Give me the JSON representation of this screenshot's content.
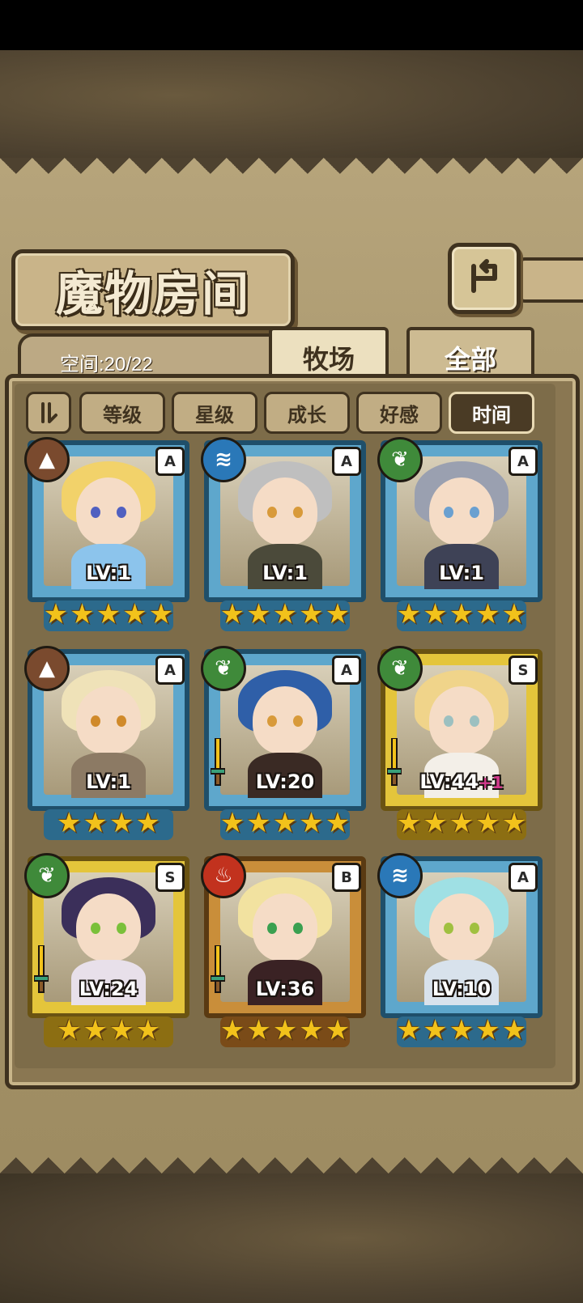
{
  "title": "魔物房间",
  "back_icon": "back-arrow-icon",
  "space": {
    "label": "空间:20/22"
  },
  "tabs": [
    {
      "label": "牧场",
      "active": true
    },
    {
      "label": "全部",
      "active": false
    }
  ],
  "sort": {
    "toggle_icon": "sort-order-icon",
    "buttons": [
      {
        "label": "等级",
        "active": false
      },
      {
        "label": "星级",
        "active": false
      },
      {
        "label": "成长",
        "active": false
      },
      {
        "label": "好感",
        "active": false
      },
      {
        "label": "时间",
        "active": true
      }
    ]
  },
  "monsters": [
    {
      "level": "LV:1",
      "bonus": "",
      "rank": "A",
      "element": "earth",
      "element_icon": "mountain-icon",
      "stars": 5,
      "frame": "blue",
      "has_sword": false
    },
    {
      "level": "LV:1",
      "bonus": "",
      "rank": "A",
      "element": "water",
      "element_icon": "wave-icon",
      "stars": 5,
      "frame": "blue",
      "has_sword": false
    },
    {
      "level": "LV:1",
      "bonus": "",
      "rank": "A",
      "element": "nature",
      "element_icon": "leaf-icon",
      "stars": 5,
      "frame": "blue",
      "has_sword": false
    },
    {
      "level": "LV:1",
      "bonus": "",
      "rank": "A",
      "element": "earth",
      "element_icon": "mountain-icon",
      "stars": 4,
      "frame": "blue",
      "has_sword": false
    },
    {
      "level": "LV:20",
      "bonus": "",
      "rank": "A",
      "element": "nature",
      "element_icon": "leaf-icon",
      "stars": 5,
      "frame": "blue",
      "has_sword": true
    },
    {
      "level": "LV:44",
      "bonus": "+1",
      "rank": "S",
      "element": "nature",
      "element_icon": "leaf-icon",
      "stars": 5,
      "frame": "gold",
      "has_sword": true
    },
    {
      "level": "LV:24",
      "bonus": "",
      "rank": "S",
      "element": "nature",
      "element_icon": "leaf-icon",
      "stars": 4,
      "frame": "gold",
      "has_sword": true
    },
    {
      "level": "LV:36",
      "bonus": "",
      "rank": "B",
      "element": "fire",
      "element_icon": "flame-icon",
      "stars": 5,
      "frame": "bronze",
      "has_sword": true
    },
    {
      "level": "LV:10",
      "bonus": "",
      "rank": "A",
      "element": "water",
      "element_icon": "wave-icon",
      "stars": 5,
      "frame": "blue",
      "has_sword": false
    }
  ],
  "colors": {
    "earth": "#7a4a2e",
    "water": "#2a78b8",
    "nature": "#3f8a3a",
    "fire": "#c2321e",
    "star": "#f2c21b",
    "panel": "#b6a47b",
    "frame_dark": "#3f321f"
  }
}
